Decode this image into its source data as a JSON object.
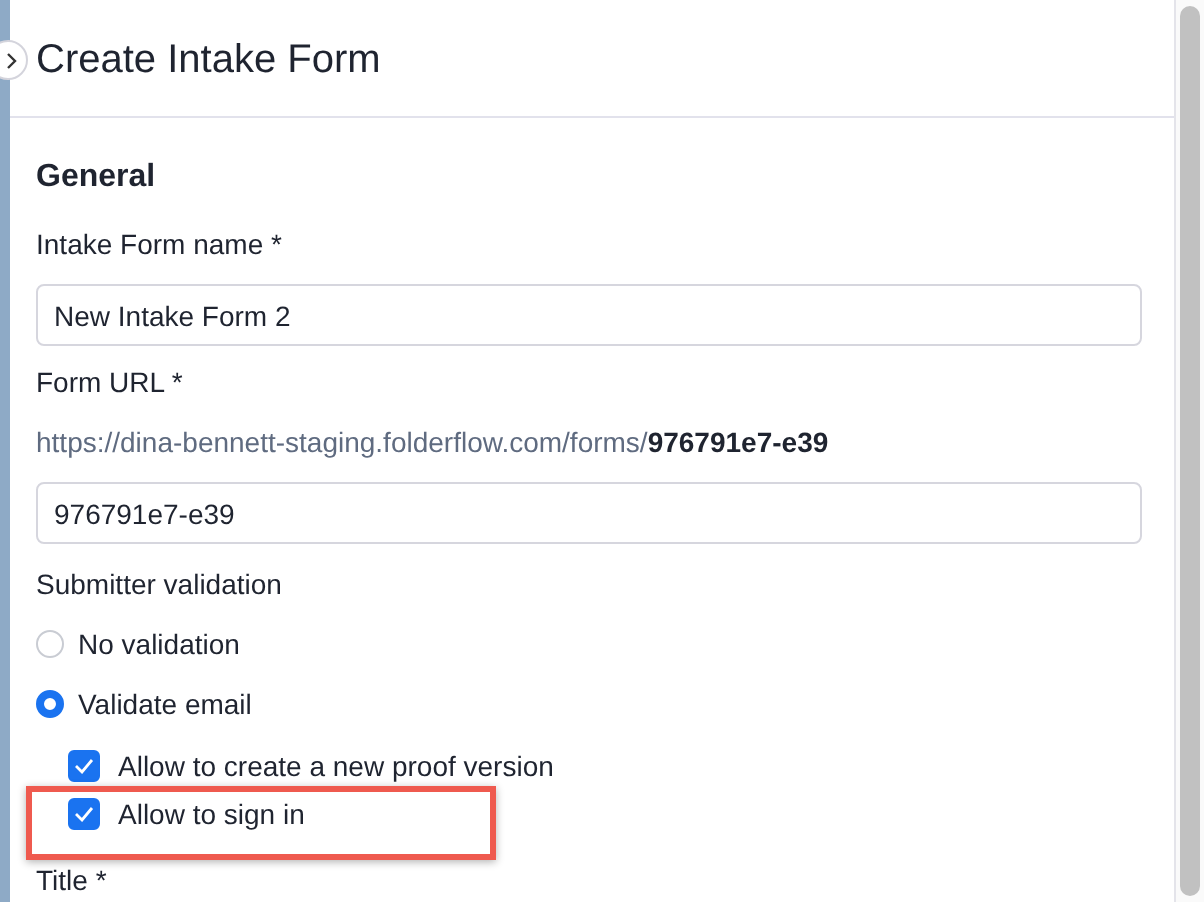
{
  "panel": {
    "title": "Create Intake Form"
  },
  "section": {
    "heading": "General"
  },
  "fields": [
    {
      "kind": "text",
      "label": "Intake Form name *",
      "value": "New Intake Form 2"
    },
    {
      "kind": "url",
      "label": "Form URL *",
      "preview": "https://dina-bennett-staging.folderflow.com/forms/**976791e7-e39**",
      "slug": "976791e7-e39"
    },
    {
      "kind": "choices",
      "label": "Submitter validation",
      "options": [
        {
          "label": "No validation",
          "selected": false
        },
        {
          "label": "Validate email",
          "selected": true,
          "children": [
            {
              "label": "Allow to create a new proof version",
              "checked": true
            },
            {
              "label": "Allow to sign in",
              "checked": true
            }
          ]
        }
      ]
    },
    {
      "kind": "heading",
      "label": "Title *"
    }
  ]
}
